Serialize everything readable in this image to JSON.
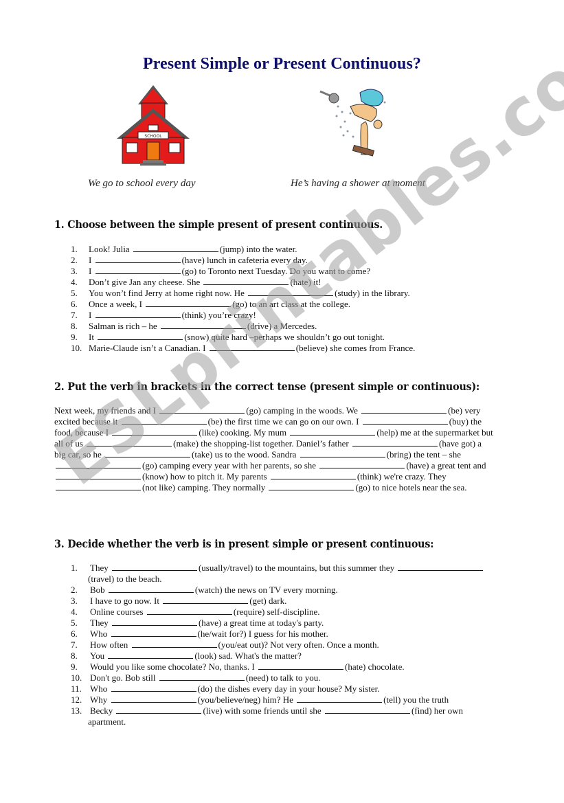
{
  "title": "Present Simple or Present Continuous?",
  "images": {
    "left": "schoolhouse-illustration",
    "right": "man-showering-illustration"
  },
  "captions": {
    "left": "We go to school every day",
    "right": "He’s having a shower at moment"
  },
  "watermark": "ESLprintables.com",
  "section1": {
    "heading": "1. Choose between the simple present of present continuous.",
    "items": [
      {
        "num": "1.",
        "pre": "Look! Julia",
        "post": "(jump) into the water."
      },
      {
        "num": "2.",
        "pre": "I",
        "post": "(have) lunch in cafeteria every day."
      },
      {
        "num": "3.",
        "pre": "I",
        "post": "(go) to Toronto next Tuesday. Do you want to come?"
      },
      {
        "num": "4.",
        "pre": "Don’t give Jan any cheese. She",
        "post": "(hate) it!"
      },
      {
        "num": "5.",
        "pre": "You won’t find Jerry at home right now. He",
        "post": "(study) in the library."
      },
      {
        "num": "6.",
        "pre": "Once a week, I",
        "post": "(go) to an art class at the college."
      },
      {
        "num": "7.",
        "pre": "I",
        "post": "(think) you’re crazy!"
      },
      {
        "num": "8.",
        "pre": "Salman is rich – he",
        "post": "(drive) a Mercedes."
      },
      {
        "num": "9.",
        "pre": "It",
        "post": "(snow) quite hard –perhaps we shouldn’t go out tonight."
      },
      {
        "num": "10.",
        "pre": "Marie-Claude isn’t a Canadian. I",
        "post": "(believe) she comes from France."
      }
    ]
  },
  "section2": {
    "heading": "2. Put the verb in brackets in the correct tense (present simple or continuous):",
    "lines": [
      [
        "Next week, my friends and I",
        "(go) camping in the woods. We",
        "(be) very"
      ],
      [
        "excited because it",
        "(be) the first time we can go on our own. I",
        "(buy) the"
      ],
      [
        "food, because I",
        "(like) cooking. My mum",
        "(help) me at the supermarket but"
      ],
      [
        "all of us",
        "(make) the shopping-list together. Daniel’s father",
        "(have got) a"
      ],
      [
        "big car, so he",
        "(take) us to the wood. Sandra",
        "(bring) the tent – she"
      ],
      [
        "",
        "(go) camping every year with her parents, so she",
        "(have) a great tent and"
      ],
      [
        "",
        "(know) how to pitch it. My parents",
        "(think) we're crazy. They"
      ],
      [
        "",
        "(not like) camping. They normally",
        "(go) to nice hotels near the sea."
      ]
    ]
  },
  "section3": {
    "heading": "3. Decide whether the verb is in present simple or present continuous:",
    "items": [
      {
        "num": "1.",
        "parts": [
          "They",
          "(usually/travel) to the mountains, but this summer they",
          ""
        ],
        "cont": "(travel) to the beach."
      },
      {
        "num": "2.",
        "parts": [
          "Bob",
          "(watch) the news on TV every morning."
        ]
      },
      {
        "num": "3.",
        "parts": [
          "I have to go now. It",
          "(get) dark."
        ]
      },
      {
        "num": "4.",
        "parts": [
          "Online courses",
          "(require) self-discipline."
        ]
      },
      {
        "num": "5.",
        "parts": [
          "They",
          "(have) a great time at today's party."
        ]
      },
      {
        "num": "6.",
        "parts": [
          "Who",
          "(he/wait for?) I guess for his mother."
        ]
      },
      {
        "num": "7.",
        "parts": [
          "How often",
          "(you/eat out)? Not very often. Once a month."
        ]
      },
      {
        "num": "8.",
        "parts": [
          "You",
          "(look) sad. What's the matter?"
        ]
      },
      {
        "num": "9.",
        "parts": [
          "Would you like some chocolate? No, thanks. I",
          "(hate) chocolate."
        ]
      },
      {
        "num": "10.",
        "parts": [
          "Don't go. Bob still",
          "(need) to talk to you."
        ]
      },
      {
        "num": "11.",
        "parts": [
          "Who",
          "(do) the dishes every day in your house? My sister."
        ]
      },
      {
        "num": "12.",
        "parts": [
          "Why",
          "(you/believe/neg) him? He",
          "(tell) you the truth"
        ]
      },
      {
        "num": "13.",
        "parts": [
          "Becky",
          "(live) with some friends until she",
          "(find) her own"
        ],
        "cont": "apartment."
      }
    ]
  }
}
